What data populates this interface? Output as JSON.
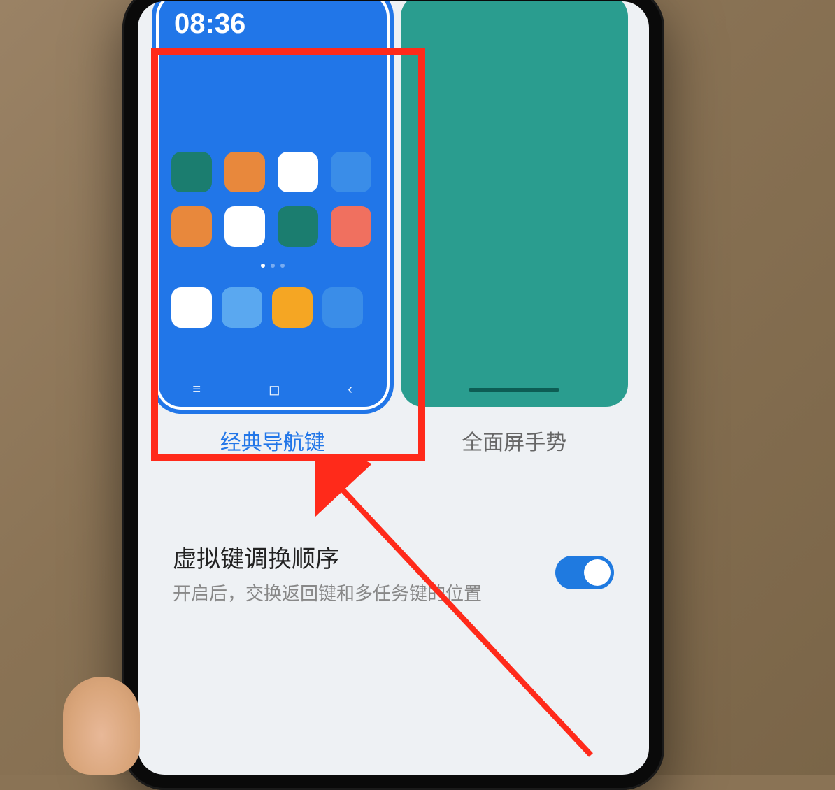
{
  "status_time": "08:36",
  "navigation_options": {
    "classic": {
      "label": "经典导航键",
      "selected": true
    },
    "gesture": {
      "label": "全面屏手势",
      "selected": false
    }
  },
  "setting": {
    "title": "虚拟键调换顺序",
    "description": "开启后，交换返回键和多任务键的位置",
    "enabled": true
  },
  "nav_icons": {
    "menu": "≡",
    "home": "◻",
    "back": "‹"
  }
}
